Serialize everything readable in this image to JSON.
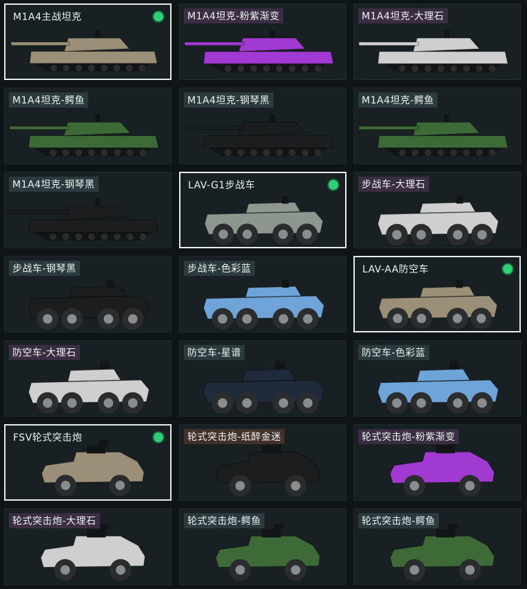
{
  "cards": [
    {
      "label": "M1A4主战坦克",
      "kind": "tank",
      "camo": "desert",
      "selected": true,
      "label_bg": "#2b3a3c"
    },
    {
      "label": "M1A4坦克-粉紫渐变",
      "kind": "tank",
      "camo": "purple",
      "selected": false,
      "label_bg": "#3a2d44"
    },
    {
      "label": "M1A4坦克-大理石",
      "kind": "tank",
      "camo": "marble",
      "selected": false,
      "label_bg": "#3a2d44"
    },
    {
      "label": "M1A4坦克-鳄鱼",
      "kind": "tank",
      "camo": "croc",
      "selected": false,
      "label_bg": "#2b3a3c"
    },
    {
      "label": "M1A4坦克-钢琴黑",
      "kind": "tank",
      "camo": "black",
      "selected": false,
      "label_bg": "#2b3a3c"
    },
    {
      "label": "M1A4坦克-鳄鱼",
      "kind": "tank",
      "camo": "croc",
      "selected": false,
      "label_bg": "#2b3a3c"
    },
    {
      "label": "M1A4坦克-钢琴黑",
      "kind": "tank",
      "camo": "black",
      "selected": false,
      "label_bg": "#2b3a3c"
    },
    {
      "label": "LAV-G1步战车",
      "kind": "ifv",
      "camo": "grey",
      "selected": true,
      "label_bg": "#2b3a3c"
    },
    {
      "label": "步战车-大理石",
      "kind": "ifv",
      "camo": "marble",
      "selected": false,
      "label_bg": "#3a2d44"
    },
    {
      "label": "步战车-钢琴黑",
      "kind": "ifv",
      "camo": "black",
      "selected": false,
      "label_bg": "#2b3a3c"
    },
    {
      "label": "步战车-色彩蓝",
      "kind": "ifv",
      "camo": "blue",
      "selected": false,
      "label_bg": "#2b3a3c"
    },
    {
      "label": "LAV-AA防空车",
      "kind": "ifv",
      "camo": "desert",
      "selected": true,
      "label_bg": "#2b3a3c"
    },
    {
      "label": "防空车-大理石",
      "kind": "aa",
      "camo": "marble",
      "selected": false,
      "label_bg": "#3a2d44"
    },
    {
      "label": "防空车-星谱",
      "kind": "aa",
      "camo": "navy",
      "selected": false,
      "label_bg": "#2b3a3c"
    },
    {
      "label": "防空车-色彩蓝",
      "kind": "aa",
      "camo": "blue",
      "selected": false,
      "label_bg": "#2b3a3c"
    },
    {
      "label": "FSV轮式突击炮",
      "kind": "fsv",
      "camo": "desert",
      "selected": true,
      "label_bg": "#2b3a3c"
    },
    {
      "label": "轮式突击炮-纸醉金迷",
      "kind": "fsv",
      "camo": "black",
      "selected": false,
      "label_bg": "#44302a"
    },
    {
      "label": "轮式突击炮-粉紫渐变",
      "kind": "fsv",
      "camo": "purple",
      "selected": false,
      "label_bg": "#3a2d44"
    },
    {
      "label": "轮式突击炮-大理石",
      "kind": "fsv",
      "camo": "marble",
      "selected": false,
      "label_bg": "#3a2d44"
    },
    {
      "label": "轮式突击炮-鳄鱼",
      "kind": "fsv",
      "camo": "croc",
      "selected": false,
      "label_bg": "#2b3a3c"
    },
    {
      "label": "轮式突击炮-鳄鱼",
      "kind": "fsv",
      "camo": "croc",
      "selected": false,
      "label_bg": "#2b3a3c"
    }
  ],
  "camo_colors": {
    "desert": "#9b8f78",
    "purple": "#a03ad0",
    "marble": "#cfcfcf",
    "croc": "#3d6a36",
    "black": "#1c1d1f",
    "grey": "#8e978f",
    "blue": "#6ea4d8",
    "navy": "#1f2a3a"
  },
  "selected_indicator_color": "#2ecf77"
}
